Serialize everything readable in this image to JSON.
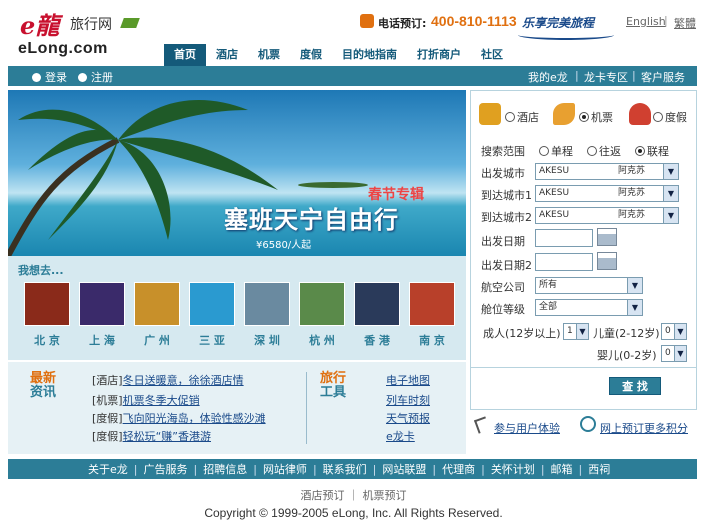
{
  "brand": {
    "logo_cn": "旅行网",
    "logo_en": "eLong.com",
    "logo_glyph": "e龍"
  },
  "header": {
    "phone_label": "电话预订:",
    "phone_number": "400-810-1113",
    "slogan": "乐享完美旅程",
    "lang_en": "English",
    "lang_tw": "繁體"
  },
  "nav": [
    "首页",
    "酒店",
    "机票",
    "度假",
    "目的地指南",
    "打折商户",
    "社区"
  ],
  "subbar": {
    "login": "登录",
    "register": "注册",
    "my_elong": "我的e龙",
    "vip": "龙卡专区",
    "service": "客户服务"
  },
  "banner": {
    "subtitle": "春节专辑",
    "title": "塞班天宁自由行",
    "price": "¥6580/人起"
  },
  "destinations": {
    "heading": "我想去...",
    "items": [
      {
        "label": "北 京",
        "color": "#8a2a1a"
      },
      {
        "label": "上 海",
        "color": "#3a2a6a"
      },
      {
        "label": "广 州",
        "color": "#c8902a"
      },
      {
        "label": "三 亚",
        "color": "#2a9ad0"
      },
      {
        "label": "深 圳",
        "color": "#6a8aa0"
      },
      {
        "label": "杭 州",
        "color": "#5a8a4a"
      },
      {
        "label": "香 港",
        "color": "#2a3a5a"
      },
      {
        "label": "南 京",
        "color": "#b8402a"
      }
    ]
  },
  "news": {
    "title_a": "最新",
    "title_b": "资讯",
    "items": [
      {
        "tag": "[酒店]",
        "text": "冬日送暖意，徐徐酒店情"
      },
      {
        "tag": "[机票]",
        "text": "机票冬季大促销"
      },
      {
        "tag": "[度假]",
        "text": "飞向阳光海岛，体验性感沙滩"
      },
      {
        "tag": "[度假]",
        "text": "轻松玩“赚”香港游"
      }
    ]
  },
  "tools": {
    "title_a": "旅行",
    "title_b": "工具",
    "items": [
      "电子地图",
      "列车时刻",
      "天气预报",
      "e龙卡"
    ]
  },
  "search": {
    "tab_hotel": "酒店",
    "tab_flight": "机票",
    "tab_vacation": "度假",
    "range_label": "搜索范围",
    "opt_oneway": "单程",
    "opt_return": "往返",
    "opt_multi": "联程",
    "from_label": "出发城市",
    "to1_label": "到达城市1",
    "to2_label": "到达城市2",
    "city_code": "AKESU",
    "city_cn": "阿克苏",
    "date_label": "出发日期",
    "date2_label": "出发日期2",
    "airline_label": "航空公司",
    "airline_value": "所有",
    "class_label": "舱位等级",
    "class_value": "全部",
    "adult_label": "成人(12岁以上)",
    "adult_value": "1",
    "child_label": "儿童(2-12岁)",
    "child_value": "0",
    "infant_label": "婴儿(0-2岁)",
    "infant_value": "0",
    "button": "查 找"
  },
  "aux": {
    "experience": "参与用户体验",
    "points": "网上预订更多积分"
  },
  "footer": {
    "links": [
      "关于e龙",
      "广告服务",
      "招聘信息",
      "网站律师",
      "联系我们",
      "网站联盟",
      "代理商",
      "关怀计划",
      "邮箱",
      "西祠"
    ],
    "sub_links": "酒店预订 ｜ 机票预订",
    "copyright": "Copyright © 1999-2005 eLong, Inc. All Rights Reserved."
  }
}
